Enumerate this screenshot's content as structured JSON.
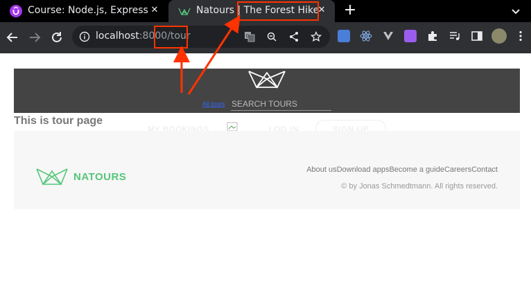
{
  "browser": {
    "tabs": [
      {
        "title": "Course: Node.js, Express, MongoDB & More",
        "icon": "udemy-icon",
        "active": false
      },
      {
        "title": "Natours | The Forest Hiker",
        "icon": "natours-icon",
        "active": true
      }
    ],
    "address": {
      "host": "localhost",
      "path": ":8000/tour"
    }
  },
  "page": {
    "nav_link": "All tours",
    "search_placeholder": "SEARCH TOURS",
    "heading": "This is tour page",
    "ghost_items": [
      "MY BOOKINGS",
      "LOG IN",
      "SIGN UP"
    ]
  },
  "footer": {
    "brand": "NATOURS",
    "links": [
      "About us",
      "Download apps",
      "Become a guide",
      "Careers",
      "Contact"
    ],
    "copyright": "© by Jonas Schmedtmann. All rights reserved."
  },
  "colors": {
    "annotation": "#ff3300",
    "brand_green": "#55c57a",
    "header_bg": "#444444"
  }
}
